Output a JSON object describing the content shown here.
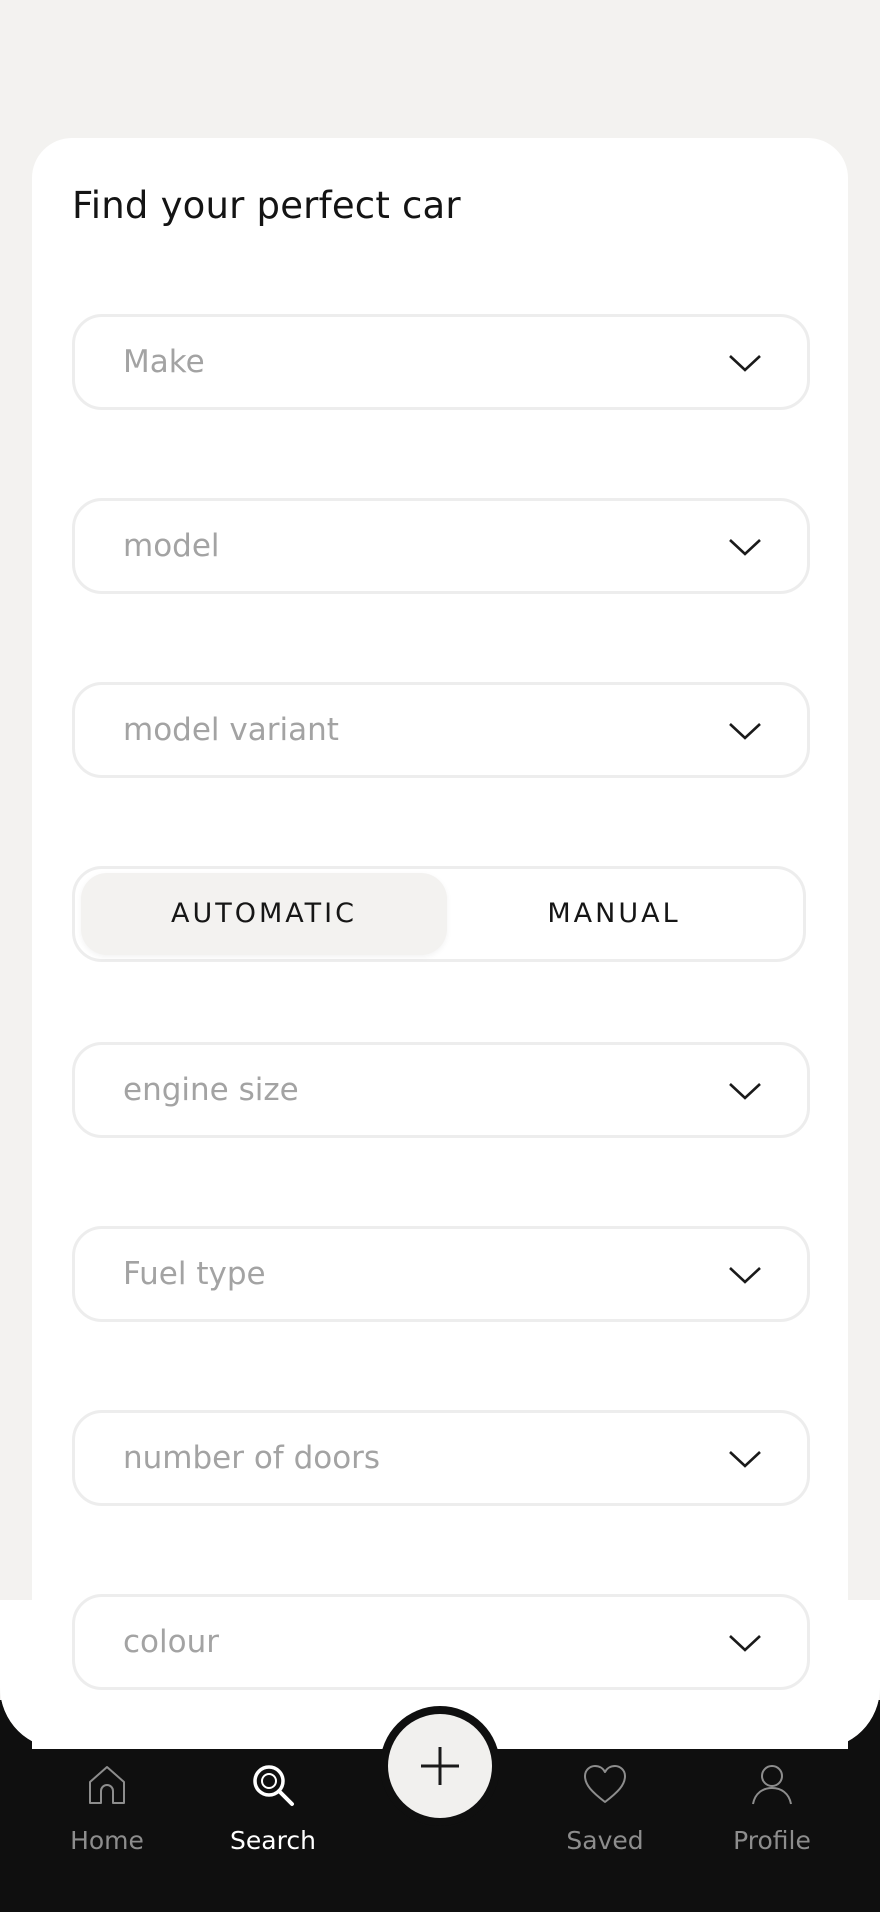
{
  "form": {
    "title": "Find your perfect car",
    "fields": [
      {
        "label": "Make"
      },
      {
        "label": "model"
      },
      {
        "label": "model variant"
      },
      {
        "label": "engine size"
      },
      {
        "label": "Fuel type"
      },
      {
        "label": "number of doors"
      },
      {
        "label": "colour"
      }
    ],
    "transmission": {
      "options": [
        "AUTOMATIC",
        "MANUAL"
      ],
      "selected": "AUTOMATIC"
    }
  },
  "nav": {
    "items": [
      {
        "label": "Home",
        "icon": "home-icon"
      },
      {
        "label": "Search",
        "icon": "search-icon"
      },
      {
        "label": "Saved",
        "icon": "heart-icon"
      },
      {
        "label": "Profile",
        "icon": "profile-icon"
      }
    ],
    "active": "Search",
    "fab_icon": "plus-icon"
  },
  "colors": {
    "background": "#f3f2f0",
    "card": "#ffffff",
    "nav_bar": "#0f0f0f",
    "placeholder": "#a3a3a3",
    "active_nav_label": "#ffffff"
  }
}
